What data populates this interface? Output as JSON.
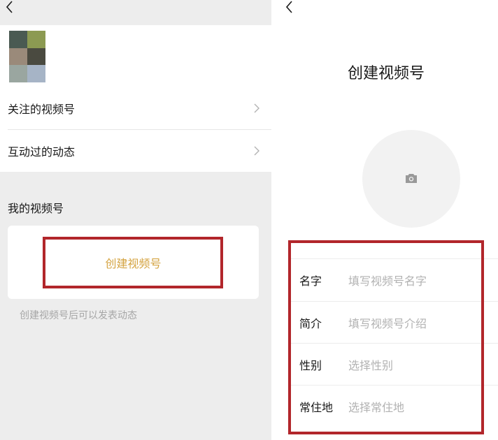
{
  "left_screen": {
    "avatar_mosaic_colors": [
      "#4a5a52",
      "#8c9a52",
      "#9a8a7a",
      "#4a4a40",
      "#9aa6a0",
      "#a6b4c6"
    ],
    "menu": [
      {
        "label": "关注的视频号"
      },
      {
        "label": "互动过的动态"
      }
    ],
    "section_title": "我的视频号",
    "create_button_label": "创建视频号",
    "hint_text": "创建视频号后可以发表动态"
  },
  "right_screen": {
    "title": "创建视频号",
    "avatar_icon": "camera-icon",
    "fields": [
      {
        "label": "名字",
        "placeholder": "填写视频号名字"
      },
      {
        "label": "简介",
        "placeholder": "填写视频号介绍"
      },
      {
        "label": "性别",
        "placeholder": "选择性别"
      },
      {
        "label": "常住地",
        "placeholder": "选择常住地"
      }
    ]
  },
  "colors": {
    "highlight": "#b2262b",
    "accent_text": "#d4a340",
    "background_gray": "#ededed",
    "placeholder_gray": "#b2b2b2"
  }
}
